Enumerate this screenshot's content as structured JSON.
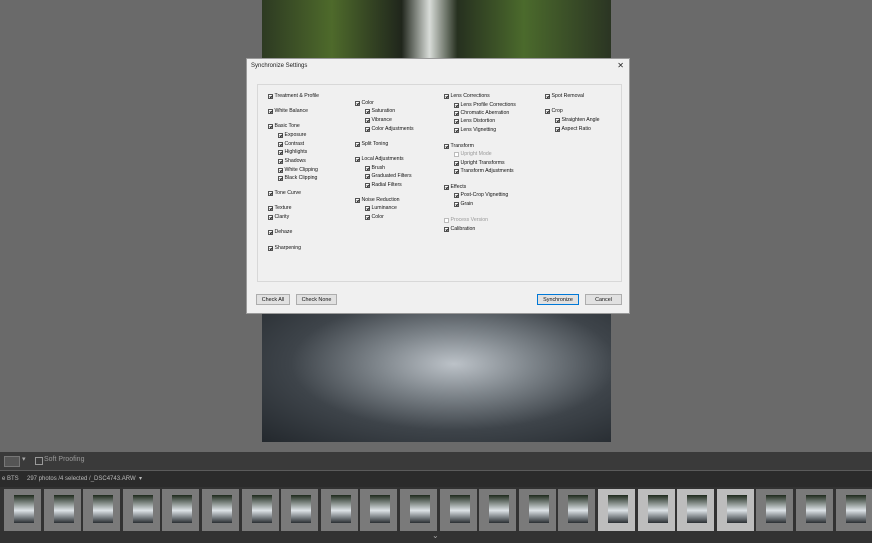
{
  "dialog": {
    "title": "Synchronize Settings",
    "close_glyph": "✕",
    "buttons": {
      "check_all": "Check All",
      "check_none": "Check None",
      "synchronize": "Synchronize",
      "cancel": "Cancel"
    },
    "col1": [
      {
        "label": "Treatment & Profile",
        "checked": true
      },
      {
        "label": "White Balance",
        "checked": true
      },
      {
        "label": "Basic Tone",
        "checked": true
      },
      {
        "label": "Exposure",
        "checked": true
      },
      {
        "label": "Contrast",
        "checked": true
      },
      {
        "label": "Highlights",
        "checked": true
      },
      {
        "label": "Shadows",
        "checked": true
      },
      {
        "label": "White Clipping",
        "checked": true
      },
      {
        "label": "Black Clipping",
        "checked": true
      },
      {
        "label": "Tone Curve",
        "checked": true
      },
      {
        "label": "Texture",
        "checked": true
      },
      {
        "label": "Clarity",
        "checked": true
      },
      {
        "label": "Dehaze",
        "checked": true
      },
      {
        "label": "Sharpening",
        "checked": true
      }
    ],
    "col2": [
      {
        "label": "Color",
        "checked": true
      },
      {
        "label": "Saturation",
        "checked": true
      },
      {
        "label": "Vibrance",
        "checked": true
      },
      {
        "label": "Color Adjustments",
        "checked": true
      },
      {
        "label": "Split Toning",
        "checked": true
      },
      {
        "label": "Local Adjustments",
        "checked": true
      },
      {
        "label": "Brush",
        "checked": true
      },
      {
        "label": "Graduated Filters",
        "checked": true
      },
      {
        "label": "Radial Filters",
        "checked": true
      },
      {
        "label": "Noise Reduction",
        "checked": true
      },
      {
        "label": "Luminance",
        "checked": true
      },
      {
        "label": "Color",
        "checked": true
      }
    ],
    "col3": [
      {
        "label": "Lens Corrections",
        "checked": true
      },
      {
        "label": "Lens Profile Corrections",
        "checked": true
      },
      {
        "label": "Chromatic Aberration",
        "checked": true
      },
      {
        "label": "Lens Distortion",
        "checked": true
      },
      {
        "label": "Lens Vignetting",
        "checked": true
      },
      {
        "label": "Transform",
        "checked": true
      },
      {
        "label": "Upright Mode",
        "checked": false,
        "disabled": true
      },
      {
        "label": "Upright Transforms",
        "checked": true
      },
      {
        "label": "Transform Adjustments",
        "checked": true
      },
      {
        "label": "Effects",
        "checked": true
      },
      {
        "label": "Post-Crop Vignetting",
        "checked": true
      },
      {
        "label": "Grain",
        "checked": true
      },
      {
        "label": "Process Version",
        "checked": false,
        "disabled": true
      },
      {
        "label": "Calibration",
        "checked": true
      }
    ],
    "col4": [
      {
        "label": "Spot Removal",
        "checked": true
      },
      {
        "label": "Crop",
        "checked": true
      },
      {
        "label": "Straighten Angle",
        "checked": true
      },
      {
        "label": "Aspect Ratio",
        "checked": true
      }
    ]
  },
  "toolbar": {
    "soft_proofing_label": "Soft Proofing"
  },
  "filmstrip": {
    "source_label": "e BTS",
    "status": "297 photos /4 selected /_DSC4743.ARW",
    "status_arrow": "▾",
    "bottom_arrow": "⌄"
  }
}
